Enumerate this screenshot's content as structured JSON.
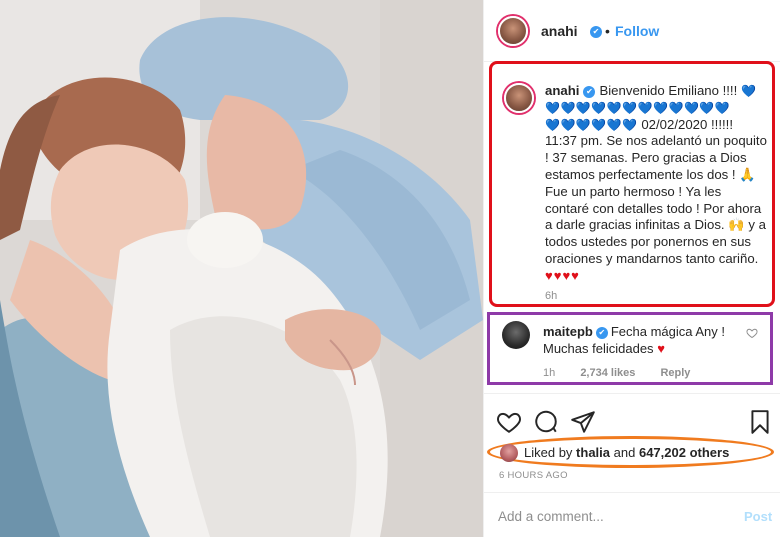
{
  "post": {
    "username": "anahi",
    "follow_label": "Follow",
    "dot": "•"
  },
  "caption": {
    "username": "anahi",
    "text_1": "Bienvenido Emiliano !!!!",
    "hearts_blue_1": "💙",
    "hearts_blue_2": "💙💙💙💙💙💙💙💙💙💙💙💙",
    "hearts_blue_3": "💙💙💙💙💙💙",
    "text_2": "02/02/2020 !!!!!!",
    "text_3": "11:37 pm. Se nos adelantó un poquito ! 37 semanas. Pero gracias a Dios estamos perfectamente los dos !",
    "pray_emoji": "🙏",
    "text_4": "Fue un parto hermoso ! Ya les contaré con detalles todo ! Por ahora a darle gracias infinitas a Dios.",
    "emoji_hands": "🙌",
    "text_5": "y a todos ustedes por ponernos en sus oraciones y mandarnos tanto cariño.",
    "hearts_red": "♥♥♥♥",
    "time": "6h"
  },
  "comment": {
    "username": "maitepb",
    "text": "Fecha mágica Any ! Muchas felicidades",
    "heart": "♥",
    "time": "1h",
    "likes": "2,734 likes",
    "reply": "Reply"
  },
  "actions": {
    "icons": [
      "heart-icon",
      "comment-icon",
      "share-icon",
      "bookmark-icon"
    ]
  },
  "likes": {
    "prefix": "Liked by",
    "user": "thalia",
    "and": "and",
    "others": "647,202 others"
  },
  "post_time": "6 HOURS AGO",
  "add_comment": {
    "placeholder": "Add a comment...",
    "post_label": "Post"
  },
  "colors": {
    "caption_highlight": "#e0101a",
    "comment_highlight": "#8e3aa8",
    "likes_highlight": "#f07b1f",
    "link_blue": "#3897f0",
    "heart_blue": "#2fb6e6"
  }
}
